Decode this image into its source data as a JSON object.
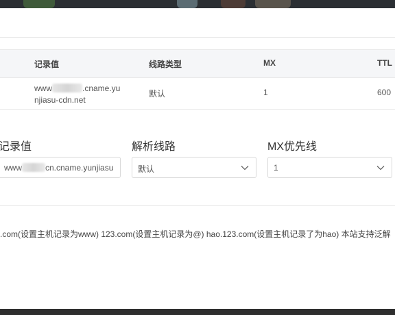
{
  "table": {
    "headers": {
      "record_value": "记录值",
      "line_type": "线路类型",
      "mx": "MX",
      "ttl": "TTL"
    },
    "rows": [
      {
        "record_prefix": "www",
        "record_suffix_line1": ".cname.yu",
        "record_line2": "njiasu-cdn.net",
        "line_type": "默认",
        "mx": "1",
        "ttl": "600"
      }
    ]
  },
  "form": {
    "record_value_label": "记录值",
    "record_value_prefix": "www",
    "record_value_suffix": "cn.cname.yunjiasu",
    "line_label": "解析线路",
    "line_value": "默认",
    "mx_label": "MX优先线",
    "mx_value": "1"
  },
  "hint": ".com(设置主机记录为www) 123.com(设置主机记录为@) hao.123.com(设置主机记录了为hao) 本站支持泛解",
  "icons": {
    "line_dropdown": "chevron-down-icon",
    "mx_dropdown": "chevron-down-icon"
  },
  "colors": {
    "table_header_bg": "#f5f6f8",
    "border": "#d9d9d9",
    "backdrop": "#2b2f33"
  }
}
